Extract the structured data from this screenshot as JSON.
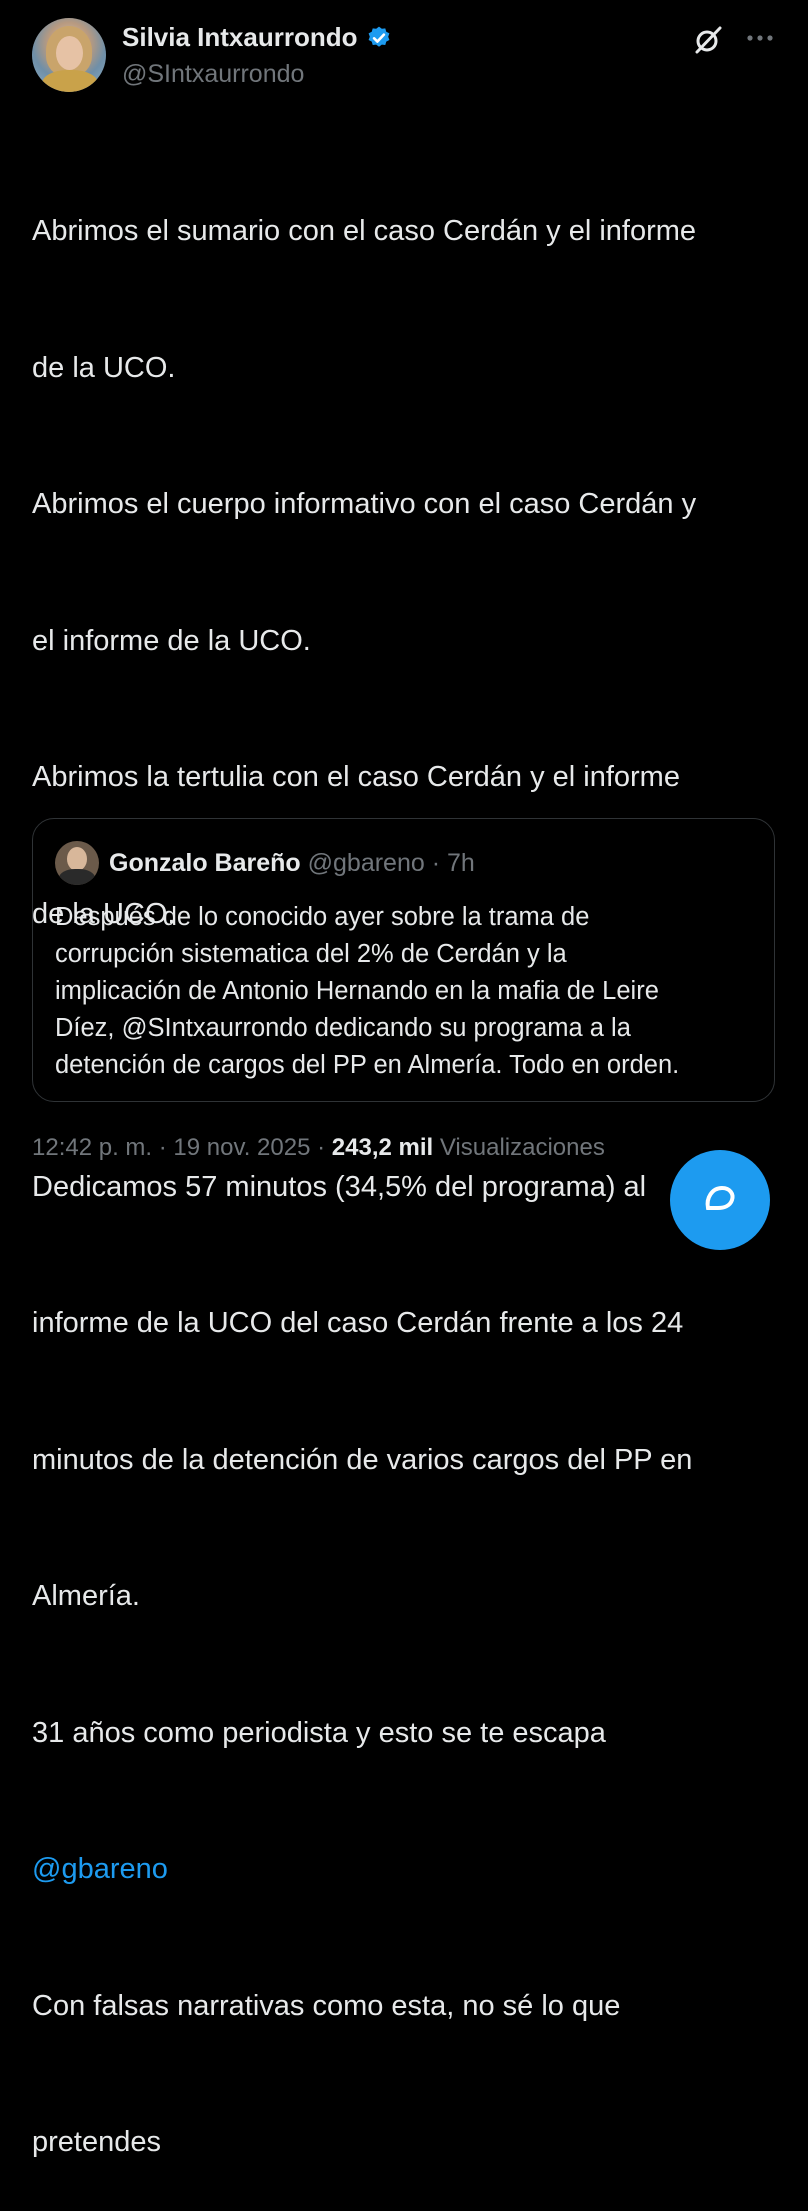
{
  "author": {
    "name": "Silvia Intxaurrondo",
    "handle": "@SIntxaurrondo",
    "verified": true
  },
  "icons": {
    "grok": "grok-icon",
    "more": "more-dots-icon",
    "verified": "verified-badge-icon",
    "compose": "compose-icon"
  },
  "colors": {
    "background": "#000000",
    "text": "#e7e9ea",
    "muted": "#71767b",
    "accent": "#1d9bf0",
    "border": "#2f3336"
  },
  "tweet": {
    "lines": [
      "Abrimos el sumario con el caso Cerdán y el informe",
      "de la UCO.",
      "Abrimos el cuerpo informativo con el caso Cerdán y",
      "el informe de la UCO.",
      "Abrimos la tertulia con el caso Cerdán y el informe",
      "de la UCO.",
      "",
      "Dedicamos 57 minutos (34,5% del programa) al",
      "informe de la UCO del caso Cerdán frente a los 24",
      "minutos de la detención de varios cargos del PP en",
      "Almería.",
      "31 años como periodista y esto se te escapa"
    ],
    "mention": "@gbareno",
    "lines_after": [
      "Con falsas narrativas como esta, no sé lo que",
      "pretendes"
    ]
  },
  "quote": {
    "name": "Gonzalo Bareño",
    "handle": "@gbareno",
    "separator": "·",
    "time": "7h",
    "lines": [
      "Después de lo conocido ayer sobre la trama de",
      "corrupción sistematica del 2% de Cerdán y la",
      "implicación de Antonio Hernando en la mafia de Leire",
      "Díez, @SIntxaurrondo dedicando su programa a la",
      "detención de cargos del PP en Almería. Todo en orden."
    ]
  },
  "meta": {
    "time": "12:42 p. m.",
    "separator": "·",
    "date": "19 nov. 2025",
    "views_count": "243,2 mil",
    "views_label": "Visualizaciones"
  }
}
